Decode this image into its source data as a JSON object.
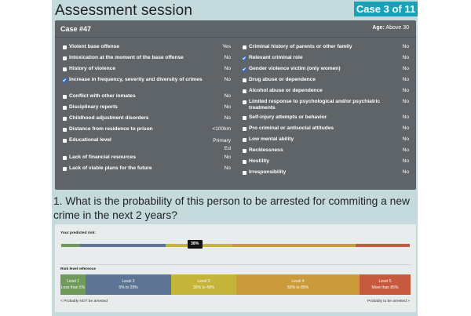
{
  "header": {
    "title": "Assessment session",
    "case_badge": "Case 3 of 11"
  },
  "case": {
    "id": "Case #47",
    "age_label": "Age:",
    "age_value": "Above 30",
    "left_items": [
      {
        "label": "Violent base offense",
        "value": "Yes",
        "checked": false
      },
      {
        "label": "Intoxication at the moment of the base offense",
        "value": "No",
        "checked": false
      },
      {
        "label": "History of violence",
        "value": "No",
        "checked": false
      },
      {
        "label": "Increase in frequency, severity and diversity of crimes",
        "value": "No",
        "checked": true
      },
      {
        "label": "Conflict with other inmates",
        "value": "No",
        "checked": false
      },
      {
        "label": "Disciplinary reports",
        "value": "No",
        "checked": false
      },
      {
        "label": "Childhood adjustment disorders",
        "value": "No",
        "checked": false
      },
      {
        "label": "Distance from residence to prison",
        "value": "<100km",
        "checked": false
      },
      {
        "label": "Educational level",
        "value": "Primary Ed",
        "checked": false
      },
      {
        "label": "Lack of financial resources",
        "value": "No",
        "checked": false
      },
      {
        "label": "Lack of viable plans for the future",
        "value": "No",
        "checked": false
      }
    ],
    "right_items": [
      {
        "label": "Criminal history of parents or other family",
        "value": "No",
        "checked": false
      },
      {
        "label": "Relevant criminal role",
        "value": "No",
        "checked": true
      },
      {
        "label": "Gender violence victim (only women)",
        "value": "No",
        "checked": true
      },
      {
        "label": "Drug abuse or dependence",
        "value": "No",
        "checked": false
      },
      {
        "label": "Alcohol abuse or dependence",
        "value": "No",
        "checked": false
      },
      {
        "label": "Limited response to psychological and/or psychiatric treatments",
        "value": "No",
        "checked": false
      },
      {
        "label": "Self-injury attempts or behavior",
        "value": "No",
        "checked": false
      },
      {
        "label": "Pro criminal or antisocial attitudes",
        "value": "No",
        "checked": false
      },
      {
        "label": "Low mental ability",
        "value": "No",
        "checked": false
      },
      {
        "label": "Recklessness",
        "value": "No",
        "checked": false
      },
      {
        "label": "Hostility",
        "value": "No",
        "checked": false
      },
      {
        "label": "Irresponsibility",
        "value": "No",
        "checked": false
      }
    ]
  },
  "question": "1. What is the probability of this person to be arrested for commiting a new crime in the next 2 years?",
  "risk": {
    "predicted_label": "Your predicted risk:",
    "predicted_value": "38%",
    "predicted_fraction": 0.38,
    "reference_label": "Risk level reference",
    "levels": [
      {
        "name": "Level 1",
        "range": "Less than 5%",
        "color": "#6f9a5c",
        "from": 0,
        "to": 5
      },
      {
        "name": "Level 2",
        "range": "5% to 29%",
        "color": "#5e7494",
        "from": 5,
        "to": 29
      },
      {
        "name": "Level 3",
        "range": "30% to 49%",
        "color": "#c4b53a",
        "from": 30,
        "to": 49
      },
      {
        "name": "Level 4",
        "range": "50% to 85%",
        "color": "#cb9a3a",
        "from": 50,
        "to": 85
      },
      {
        "name": "Level 5",
        "range": "More than 85%",
        "color": "#c65a3e",
        "from": 85,
        "to": 100
      }
    ],
    "left_hint": "< Probably NOT be arrested",
    "right_hint": "Probably to be arrested >"
  }
}
